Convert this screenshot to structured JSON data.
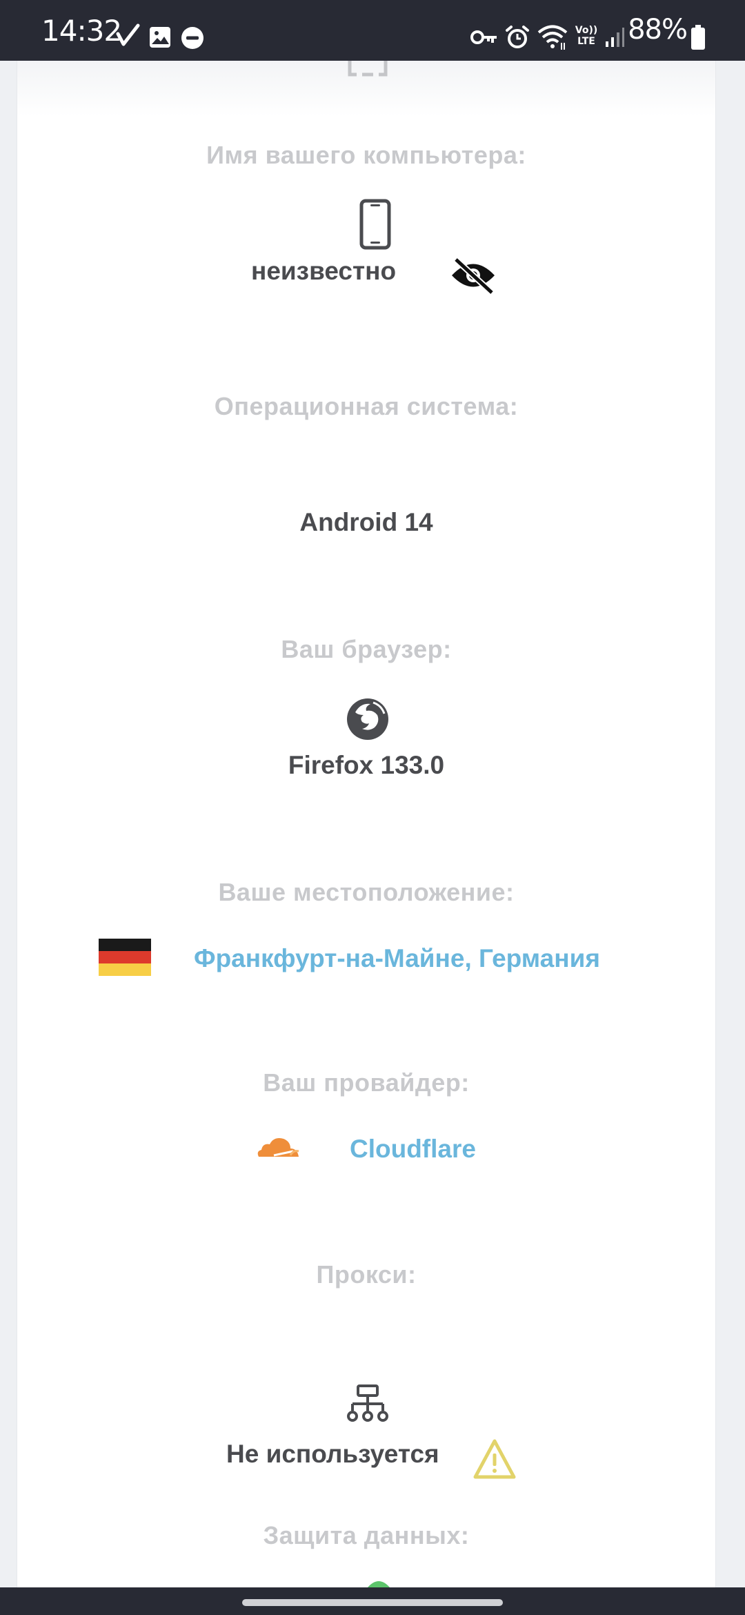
{
  "status_bar": {
    "time": "14:32",
    "battery": "88%",
    "icons": [
      "check-mark-icon",
      "gallery-icon",
      "do-not-disturb-icon",
      "vpn-key-icon",
      "alarm-icon",
      "wifi-icon",
      "volte-icon",
      "signal-icon",
      "battery-icon"
    ],
    "volte_text": "Vo)) LTE"
  },
  "info": {
    "computer_name": {
      "label": "Имя вашего компьютера:",
      "value": "неизвестно",
      "icon": "smartphone-icon",
      "hidden_icon": "eye-off-icon"
    },
    "os": {
      "label": "Операционная система:",
      "value": "Android 14"
    },
    "browser": {
      "label": "Ваш браузер:",
      "value": "Firefox 133.0",
      "icon": "firefox-icon"
    },
    "location": {
      "label": "Ваше местоположение:",
      "value": "Франкфурт-на-Майне, Германия",
      "icon": "germany-flag-icon"
    },
    "provider": {
      "label": "Ваш провайдер:",
      "value": "Cloudflare",
      "icon": "cloudflare-icon"
    },
    "proxy": {
      "label": "Прокси:",
      "value": "Не используется",
      "icon": "network-tree-icon",
      "warning_icon": "warning-icon"
    },
    "data_protection": {
      "label": "Защита данных:"
    }
  },
  "colors": {
    "status_bar_bg": "#282a34",
    "label": "#c8c9cc",
    "value": "#4a4b4f",
    "link": "#6ab6dc",
    "warning": "#e2d36a",
    "cloudflare": "#ef8e3a"
  }
}
